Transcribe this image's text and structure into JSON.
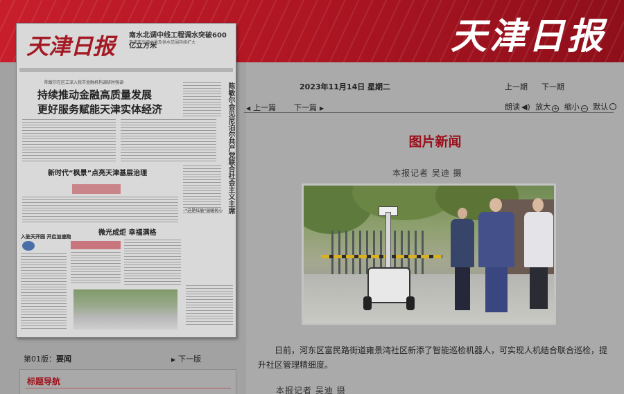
{
  "header": {
    "brand": "天津日报"
  },
  "paper": {
    "logo": "天津日报",
    "tagline": "南水北调中线工程调水突破600亿立方米",
    "subline": "天津市引调水量及供水范围持续扩大",
    "kicker": "陈敏尔在区工深入我市金融机构调研时强调",
    "headline1": "持续推动金融高质量发展",
    "headline2": "更好服务赋能天津实体经济",
    "vertical_headline": "陈敏尔会见尼泊尔共产党联合社会主义主席",
    "headline3": "新时代“枫景”点亮天津基层治理",
    "headline4": "微光成炬 幸福满格",
    "left_head": "入驻天开园 开启加速跑",
    "right_small": "“这是红盾”温暖民心"
  },
  "edition_nav": {
    "edition_label": "第01版：",
    "edition_name": "要闻",
    "next_edition": "下一版",
    "nav_title": "标题导航"
  },
  "toolbar": {
    "date": "2023年11月14日 星期二",
    "prev_issue": "上一期",
    "next_issue": "下一期",
    "prev_article": "上一篇",
    "next_article": "下一篇",
    "read_aloud": "朗读",
    "zoom_in": "放大",
    "zoom_out": "缩小",
    "default": "默认"
  },
  "article": {
    "title": "图片新闻",
    "byline": "本报记者 吴迪 摄",
    "paragraph": "日前，河东区富民路街道雍景湾社区新添了智能巡检机器人，可实现人机结合联合巡检，提升社区管理精细度。",
    "byline_bottom": "本报记者 吴迪 摄"
  }
}
